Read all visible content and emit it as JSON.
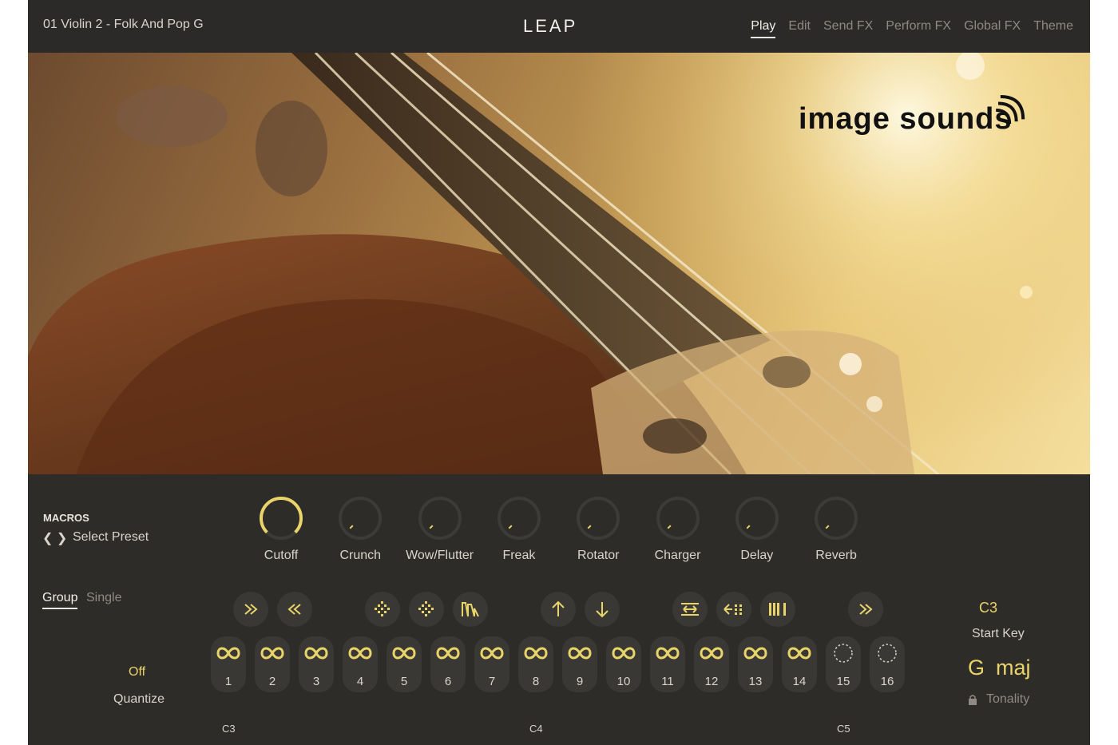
{
  "header": {
    "preset_name": "01 Violin 2 - Folk And Pop G",
    "logo": "LEAP",
    "tabs": [
      {
        "label": "Play",
        "active": true
      },
      {
        "label": "Edit",
        "active": false
      },
      {
        "label": "Send FX",
        "active": false
      },
      {
        "label": "Perform FX",
        "active": false
      },
      {
        "label": "Global FX",
        "active": false
      },
      {
        "label": "Theme",
        "active": false
      }
    ]
  },
  "hero": {
    "brand": "image sounds",
    "brand_icon": "sound-waves-icon"
  },
  "macros": {
    "title": "MACROS",
    "preset_label": "Select Preset",
    "knobs": [
      {
        "label": "Cutoff",
        "value": 1.0
      },
      {
        "label": "Crunch",
        "value": 0
      },
      {
        "label": "Wow/Flutter",
        "value": 0
      },
      {
        "label": "Freak",
        "value": 0
      },
      {
        "label": "Rotator",
        "value": 0
      },
      {
        "label": "Charger",
        "value": 0
      },
      {
        "label": "Delay",
        "value": 0
      },
      {
        "label": "Reverb",
        "value": 0
      }
    ]
  },
  "mode": {
    "group": "Group",
    "single": "Single"
  },
  "fx_buttons": [
    "fast-forward-icon",
    "rewind-icon",
    "diamond-dots-icon",
    "diamond-dots-alt-icon",
    "envelope-icon",
    "arrow-up-icon",
    "arrow-down-icon",
    "stretch-icon",
    "scatter-icon",
    "bars-icon",
    "double-chevron-right-icon"
  ],
  "pads": [
    {
      "num": "1",
      "icon": "loop-icon"
    },
    {
      "num": "2",
      "icon": "loop-icon"
    },
    {
      "num": "3",
      "icon": "loop-icon"
    },
    {
      "num": "4",
      "icon": "loop-icon"
    },
    {
      "num": "5",
      "icon": "loop-icon"
    },
    {
      "num": "6",
      "icon": "loop-icon"
    },
    {
      "num": "7",
      "icon": "loop-icon"
    },
    {
      "num": "8",
      "icon": "loop-icon"
    },
    {
      "num": "9",
      "icon": "loop-icon"
    },
    {
      "num": "10",
      "icon": "loop-icon"
    },
    {
      "num": "11",
      "icon": "loop-icon"
    },
    {
      "num": "12",
      "icon": "loop-icon"
    },
    {
      "num": "13",
      "icon": "loop-icon"
    },
    {
      "num": "14",
      "icon": "loop-icon"
    },
    {
      "num": "15",
      "icon": "dotted-circle-icon"
    },
    {
      "num": "16",
      "icon": "dotted-circle-icon"
    }
  ],
  "octaves": [
    "C3",
    "C4",
    "C5"
  ],
  "quantize": {
    "value": "Off",
    "label": "Quantize"
  },
  "start_key": {
    "value": "C3",
    "label": "Start Key"
  },
  "tonality": {
    "note": "G",
    "scale": "maj",
    "label": "Tonality"
  },
  "colors": {
    "accent": "#e9d46a",
    "background": "#2e2c29",
    "pad": "#3a3834"
  }
}
